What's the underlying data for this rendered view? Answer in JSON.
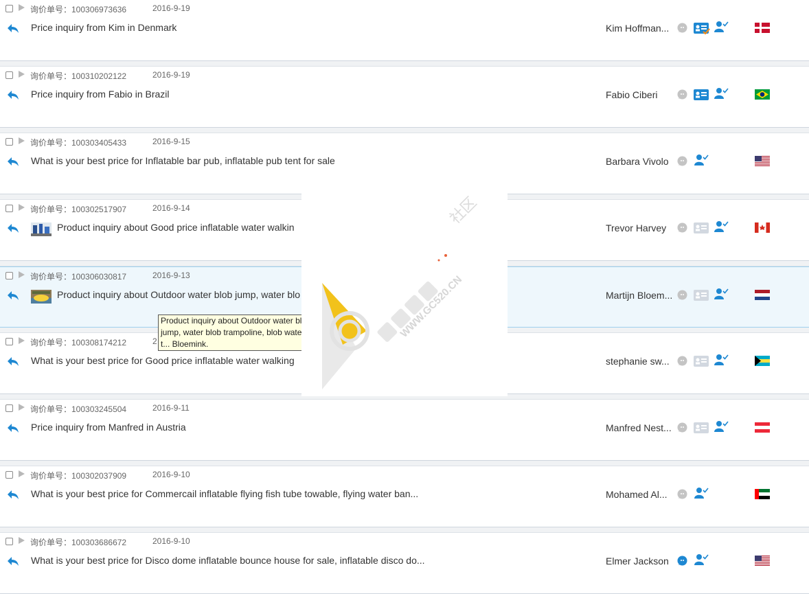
{
  "inquiry_prefix": "询价单号：",
  "rows": [
    {
      "no": "100306973636",
      "date": "2016-9-19",
      "subject": "Price inquiry from Kim in Denmark",
      "name": "Kim Hoffman...",
      "flag": "DK",
      "card": "orange-check",
      "bubble": "gray",
      "thumb": ""
    },
    {
      "no": "100310202122",
      "date": "2016-9-19",
      "subject": "Price inquiry from Fabio in Brazil",
      "name": "Fabio Ciberi",
      "flag": "BR",
      "card": "blue",
      "bubble": "gray",
      "thumb": ""
    },
    {
      "no": "100303405433",
      "date": "2016-9-15",
      "subject": "What is your best price for Inflatable bar pub, inflatable pub tent for sale",
      "name": "Barbara Vivolo",
      "flag": "US",
      "card": "none",
      "bubble": "gray",
      "thumb": ""
    },
    {
      "no": "100302517907",
      "date": "2016-9-14",
      "subject": "Product inquiry about Good price inflatable water walkin",
      "name": "Trevor Harvey",
      "flag": "CA",
      "card": "gray",
      "bubble": "gray",
      "thumb": "product-thumbnail"
    },
    {
      "no": "100306030817",
      "date": "2016-9-13",
      "subject": "Product inquiry about Outdoor water blob jump, water blo",
      "name": "Martijn Bloem...",
      "flag": "NL",
      "card": "gray",
      "bubble": "gray",
      "thumb": "product-thumbnail"
    },
    {
      "no": "100308174212",
      "date": "2",
      "subject": "What is your best price for Good price inflatable water walking",
      "name": "stephanie sw...",
      "flag": "BS",
      "card": "gray",
      "bubble": "gray",
      "thumb": ""
    },
    {
      "no": "100303245504",
      "date": "2016-9-11",
      "subject": "Price inquiry from Manfred in Austria",
      "name": "Manfred Nest...",
      "flag": "AT",
      "card": "gray",
      "bubble": "gray",
      "thumb": ""
    },
    {
      "no": "100302037909",
      "date": "2016-9-10",
      "subject": "What is your best price for Commercail inflatable flying fish tube towable, flying water ban...",
      "name": "Mohamed Al...",
      "flag": "AE",
      "card": "none",
      "bubble": "gray",
      "thumb": ""
    },
    {
      "no": "100303686672",
      "date": "2016-9-10",
      "subject": "What is your best price for Disco dome inflatable bounce house for sale, inflatable disco do...",
      "name": "Elmer Jackson",
      "flag": "US",
      "card": "none",
      "bubble": "blue",
      "thumb": ""
    }
  ],
  "tooltip": {
    "text": "Product inquiry about Outdoor water blob jump, water blob trampoline, blob water t... Bloemink."
  },
  "watermark": {
    "url_text": "WWW.GC520.CN",
    "side_text": "社区"
  },
  "colors": {
    "accent": "#1e88d2",
    "row_highlight": "#eef7fc",
    "tooltip_bg": "#ffffe1",
    "watermark_yellow": "#f2c21b"
  }
}
